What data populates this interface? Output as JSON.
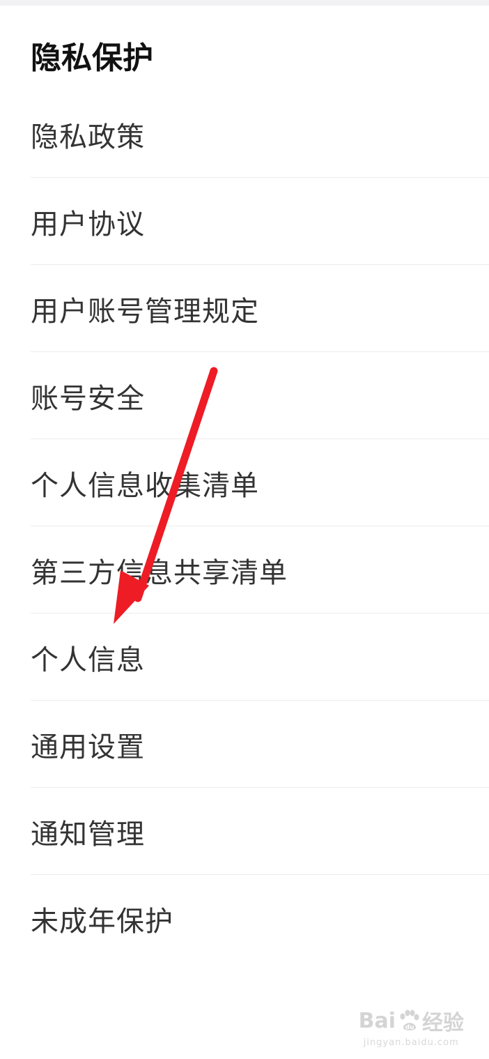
{
  "section": {
    "title": "隐私保护"
  },
  "menu": {
    "items": [
      {
        "label": "隐私政策"
      },
      {
        "label": "用户协议"
      },
      {
        "label": "用户账号管理规定"
      },
      {
        "label": "账号安全"
      },
      {
        "label": "个人信息收集清单"
      },
      {
        "label": "第三方信息共享清单"
      },
      {
        "label": "个人信息"
      },
      {
        "label": "通用设置"
      },
      {
        "label": "通知管理"
      },
      {
        "label": "未成年保护"
      }
    ]
  },
  "annotation": {
    "arrow_color": "#ee1c24",
    "target": "个人信息"
  },
  "watermark": {
    "brand_left": "Bai",
    "brand_right": "经验",
    "url": "jingyan.baidu.com"
  }
}
